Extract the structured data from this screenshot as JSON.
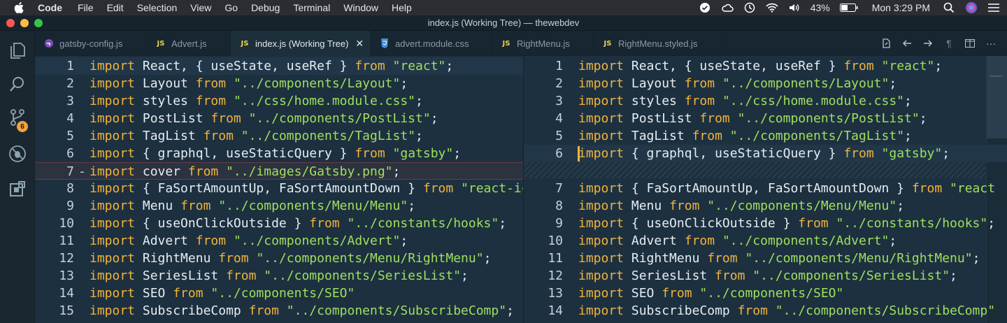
{
  "menubar": {
    "app": "Code",
    "items": [
      "File",
      "Edit",
      "Selection",
      "View",
      "Go",
      "Debug",
      "Terminal",
      "Window",
      "Help"
    ],
    "battery": "43%",
    "clock": "Mon 3:29 PM"
  },
  "window": {
    "title": "index.js (Working Tree) — thewebdev"
  },
  "activity_bar": {
    "scm_badge": "6"
  },
  "tabs": [
    {
      "label": "gatsby-config.js",
      "icon": "gatsby-icon"
    },
    {
      "label": "Advert.js",
      "icon": "js-icon"
    },
    {
      "label": "index.js (Working Tree)",
      "icon": "js-icon",
      "active": true
    },
    {
      "label": "advert.module.css",
      "icon": "css-icon"
    },
    {
      "label": "RightMenu.js",
      "icon": "js-icon"
    },
    {
      "label": "RightMenu.styled.js",
      "icon": "js-icon"
    }
  ],
  "icon_labels": {
    "js": "JS"
  },
  "left_pane": {
    "lines": [
      {
        "n": "1",
        "parts": [
          [
            "kw",
            "import"
          ],
          [
            "t",
            " React, { useState, useRef } "
          ],
          [
            "kw",
            "from"
          ],
          [
            "t",
            " "
          ],
          [
            "str",
            "\"react\""
          ],
          [
            "t",
            ";"
          ]
        ]
      },
      {
        "n": "2",
        "parts": [
          [
            "kw",
            "import"
          ],
          [
            "t",
            " Layout "
          ],
          [
            "kw",
            "from"
          ],
          [
            "t",
            " "
          ],
          [
            "str",
            "\"../components/Layout\""
          ],
          [
            "t",
            ";"
          ]
        ]
      },
      {
        "n": "3",
        "parts": [
          [
            "kw",
            "import"
          ],
          [
            "t",
            " styles "
          ],
          [
            "kw",
            "from"
          ],
          [
            "t",
            " "
          ],
          [
            "str",
            "\"../css/home.module.css\""
          ],
          [
            "t",
            ";"
          ]
        ]
      },
      {
        "n": "4",
        "parts": [
          [
            "kw",
            "import"
          ],
          [
            "t",
            " PostList "
          ],
          [
            "kw",
            "from"
          ],
          [
            "t",
            " "
          ],
          [
            "str",
            "\"../components/PostList\""
          ],
          [
            "t",
            ";"
          ]
        ]
      },
      {
        "n": "5",
        "parts": [
          [
            "kw",
            "import"
          ],
          [
            "t",
            " TagList "
          ],
          [
            "kw",
            "from"
          ],
          [
            "t",
            " "
          ],
          [
            "str",
            "\"../components/TagList\""
          ],
          [
            "t",
            ";"
          ]
        ]
      },
      {
        "n": "6",
        "parts": [
          [
            "kw",
            "import"
          ],
          [
            "t",
            " { graphql, useStaticQuery } "
          ],
          [
            "kw",
            "from"
          ],
          [
            "t",
            " "
          ],
          [
            "str",
            "\"gatsby\""
          ],
          [
            "t",
            ";"
          ]
        ]
      },
      {
        "n": "7",
        "parts": [
          [
            "kw",
            "import"
          ],
          [
            "t",
            " cover "
          ],
          [
            "kw",
            "from"
          ],
          [
            "t",
            " "
          ],
          [
            "str",
            "\"../images/Gatsby.png\""
          ],
          [
            "t",
            ";"
          ]
        ]
      },
      {
        "n": "8",
        "parts": [
          [
            "kw",
            "import"
          ],
          [
            "t",
            " { FaSortAmountUp, FaSortAmountDown } "
          ],
          [
            "kw",
            "from"
          ],
          [
            "t",
            " "
          ],
          [
            "str",
            "\"react-ic"
          ]
        ]
      },
      {
        "n": "9",
        "parts": [
          [
            "kw",
            "import"
          ],
          [
            "t",
            " Menu "
          ],
          [
            "kw",
            "from"
          ],
          [
            "t",
            " "
          ],
          [
            "str",
            "\"../components/Menu/Menu\""
          ],
          [
            "t",
            ";"
          ]
        ]
      },
      {
        "n": "10",
        "parts": [
          [
            "kw",
            "import"
          ],
          [
            "t",
            " { useOnClickOutside } "
          ],
          [
            "kw",
            "from"
          ],
          [
            "t",
            " "
          ],
          [
            "str",
            "\"../constants/hooks\""
          ],
          [
            "t",
            ";"
          ]
        ]
      },
      {
        "n": "11",
        "parts": [
          [
            "kw",
            "import"
          ],
          [
            "t",
            " Advert "
          ],
          [
            "kw",
            "from"
          ],
          [
            "t",
            " "
          ],
          [
            "str",
            "\"../components/Advert\""
          ],
          [
            "t",
            ";"
          ]
        ]
      },
      {
        "n": "12",
        "parts": [
          [
            "kw",
            "import"
          ],
          [
            "t",
            " RightMenu "
          ],
          [
            "kw",
            "from"
          ],
          [
            "t",
            " "
          ],
          [
            "str",
            "\"../components/Menu/RightMenu\""
          ],
          [
            "t",
            ";"
          ]
        ]
      },
      {
        "n": "13",
        "parts": [
          [
            "kw",
            "import"
          ],
          [
            "t",
            " SeriesList "
          ],
          [
            "kw",
            "from"
          ],
          [
            "t",
            " "
          ],
          [
            "str",
            "\"../components/SeriesList\""
          ],
          [
            "t",
            ";"
          ]
        ]
      },
      {
        "n": "14",
        "parts": [
          [
            "kw",
            "import"
          ],
          [
            "t",
            " SEO "
          ],
          [
            "kw",
            "from"
          ],
          [
            "t",
            " "
          ],
          [
            "str",
            "\"../components/SEO\""
          ]
        ]
      },
      {
        "n": "15",
        "parts": [
          [
            "kw",
            "import"
          ],
          [
            "t",
            " SubscribeComp "
          ],
          [
            "kw",
            "from"
          ],
          [
            "t",
            " "
          ],
          [
            "str",
            "\"../components/SubscribeComp\""
          ],
          [
            "t",
            ";"
          ]
        ]
      }
    ],
    "removed_marker": "-"
  },
  "right_pane": {
    "lines": [
      {
        "n": "1",
        "parts": [
          [
            "kw",
            "import"
          ],
          [
            "t",
            " React, { useState, useRef } "
          ],
          [
            "kw",
            "from"
          ],
          [
            "t",
            " "
          ],
          [
            "str",
            "\"react\""
          ],
          [
            "t",
            ";"
          ]
        ]
      },
      {
        "n": "2",
        "parts": [
          [
            "kw",
            "import"
          ],
          [
            "t",
            " Layout "
          ],
          [
            "kw",
            "from"
          ],
          [
            "t",
            " "
          ],
          [
            "str",
            "\"../components/Layout\""
          ],
          [
            "t",
            ";"
          ]
        ]
      },
      {
        "n": "3",
        "parts": [
          [
            "kw",
            "import"
          ],
          [
            "t",
            " styles "
          ],
          [
            "kw",
            "from"
          ],
          [
            "t",
            " "
          ],
          [
            "str",
            "\"../css/home.module.css\""
          ],
          [
            "t",
            ";"
          ]
        ]
      },
      {
        "n": "4",
        "parts": [
          [
            "kw",
            "import"
          ],
          [
            "t",
            " PostList "
          ],
          [
            "kw",
            "from"
          ],
          [
            "t",
            " "
          ],
          [
            "str",
            "\"../components/PostList\""
          ],
          [
            "t",
            ";"
          ]
        ]
      },
      {
        "n": "5",
        "parts": [
          [
            "kw",
            "import"
          ],
          [
            "t",
            " TagList "
          ],
          [
            "kw",
            "from"
          ],
          [
            "t",
            " "
          ],
          [
            "str",
            "\"../components/TagList\""
          ],
          [
            "t",
            ";"
          ]
        ]
      },
      {
        "n": "6",
        "parts": [
          [
            "kw",
            "import"
          ],
          [
            "t",
            " { graphql, useStaticQuery } "
          ],
          [
            "kw",
            "from"
          ],
          [
            "t",
            " "
          ],
          [
            "str",
            "\"gatsby\""
          ],
          [
            "t",
            ";"
          ]
        ]
      },
      {
        "n": "7",
        "parts": [
          [
            "kw",
            "import"
          ],
          [
            "t",
            " { FaSortAmountUp, FaSortAmountDown } "
          ],
          [
            "kw",
            "from"
          ],
          [
            "t",
            " "
          ],
          [
            "str",
            "\"react"
          ]
        ]
      },
      {
        "n": "8",
        "parts": [
          [
            "kw",
            "import"
          ],
          [
            "t",
            " Menu "
          ],
          [
            "kw",
            "from"
          ],
          [
            "t",
            " "
          ],
          [
            "str",
            "\"../components/Menu/Menu\""
          ],
          [
            "t",
            ";"
          ]
        ]
      },
      {
        "n": "9",
        "parts": [
          [
            "kw",
            "import"
          ],
          [
            "t",
            " { useOnClickOutside } "
          ],
          [
            "kw",
            "from"
          ],
          [
            "t",
            " "
          ],
          [
            "str",
            "\"../constants/hooks\""
          ],
          [
            "t",
            ";"
          ]
        ]
      },
      {
        "n": "10",
        "parts": [
          [
            "kw",
            "import"
          ],
          [
            "t",
            " Advert "
          ],
          [
            "kw",
            "from"
          ],
          [
            "t",
            " "
          ],
          [
            "str",
            "\"../components/Advert\""
          ],
          [
            "t",
            ";"
          ]
        ]
      },
      {
        "n": "11",
        "parts": [
          [
            "kw",
            "import"
          ],
          [
            "t",
            " RightMenu "
          ],
          [
            "kw",
            "from"
          ],
          [
            "t",
            " "
          ],
          [
            "str",
            "\"../components/Menu/RightMenu\""
          ],
          [
            "t",
            ";"
          ]
        ]
      },
      {
        "n": "12",
        "parts": [
          [
            "kw",
            "import"
          ],
          [
            "t",
            " SeriesList "
          ],
          [
            "kw",
            "from"
          ],
          [
            "t",
            " "
          ],
          [
            "str",
            "\"../components/SeriesList\""
          ],
          [
            "t",
            ";"
          ]
        ]
      },
      {
        "n": "13",
        "parts": [
          [
            "kw",
            "import"
          ],
          [
            "t",
            " SEO "
          ],
          [
            "kw",
            "from"
          ],
          [
            "t",
            " "
          ],
          [
            "str",
            "\"../components/SEO\""
          ]
        ]
      },
      {
        "n": "14",
        "parts": [
          [
            "kw",
            "import"
          ],
          [
            "t",
            " SubscribeComp "
          ],
          [
            "kw",
            "from"
          ],
          [
            "t",
            " "
          ],
          [
            "str",
            "\"../components/SubscribeComp\""
          ]
        ]
      }
    ]
  },
  "colors": {
    "keyword": "#f0b43c",
    "string": "#9ee05d",
    "text": "#e6edf2"
  }
}
